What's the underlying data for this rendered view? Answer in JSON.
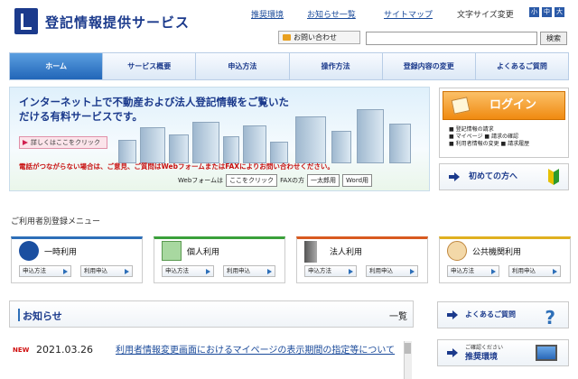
{
  "header": {
    "site_title": "登記情報提供サービス",
    "links": [
      "推奨環境",
      "お知らせ一覧",
      "サイトマップ"
    ],
    "font_size_label": "文字サイズ変更",
    "font_sizes": [
      "小",
      "中",
      "大"
    ],
    "contact": "お問い合わせ",
    "search_placeholder": "",
    "search_button": "検索"
  },
  "nav": {
    "items": [
      "ホーム",
      "サービス概要",
      "申込方法",
      "操作方法",
      "登録内容の変更",
      "よくあるご質問"
    ]
  },
  "banner": {
    "title": "インターネット上で不動産および法人登記情報をご覧いただける有料サービスです。",
    "detail_button": "詳しくはここをクリック",
    "notice": "電話がつながらない場合は、ご意見、ご質問はWebフォームまたはFAXによりお問い合わせください。",
    "webform_label": "Webフォームは",
    "webform_button": "ここをクリック",
    "fax_label": "FAXの方",
    "fax_button": "一太郎用",
    "word_button": "Word用"
  },
  "login": {
    "button": "ログイン",
    "bullets": [
      "登記情報の請求",
      "マイページ",
      "利用者情報の変更",
      "請求の確認",
      "請求履歴"
    ]
  },
  "first_time": "初めての方へ",
  "menu": {
    "label": "ご利用者別登録メニュー",
    "cards": [
      {
        "title": "一時利用",
        "b1": "申込方法",
        "b2": "利用申込"
      },
      {
        "title": "個人利用",
        "b1": "申込方法",
        "b2": "利用申込"
      },
      {
        "title": "法人利用",
        "b1": "申込方法",
        "b2": "利用申込"
      },
      {
        "title": "公共機関利用",
        "b1": "申込方法",
        "b2": "利用申込"
      }
    ]
  },
  "news": {
    "title": "お知らせ",
    "list_link": "一覧",
    "new_badge": "NEW",
    "date": "2021.03.26",
    "link_text": "利用者情報変更画面におけるマイページの表示期間の指定等について"
  },
  "side": {
    "faq": "よくあるご質問",
    "env_small": "ご確認ください",
    "env": "推奨環境"
  }
}
